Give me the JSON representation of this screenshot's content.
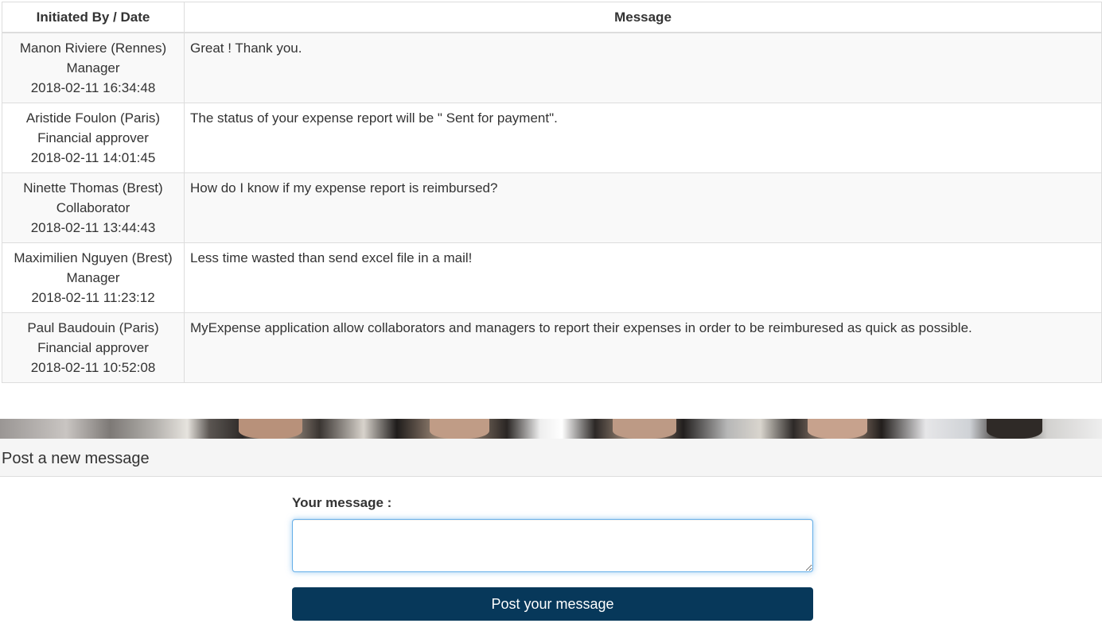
{
  "table": {
    "headers": {
      "initiator": "Initiated By / Date",
      "message": "Message"
    },
    "rows": [
      {
        "name": "Manon Riviere (Rennes)",
        "role": "Manager",
        "date": "2018-02-11 16:34:48",
        "message": "Great ! Thank you."
      },
      {
        "name": "Aristide Foulon (Paris)",
        "role": "Financial approver",
        "date": "2018-02-11 14:01:45",
        "message": "The status of your expense report will be \" Sent for payment\"."
      },
      {
        "name": "Ninette Thomas (Brest)",
        "role": "Collaborator",
        "date": "2018-02-11 13:44:43",
        "message": "How do I know if my expense report is reimbursed?"
      },
      {
        "name": "Maximilien Nguyen (Brest)",
        "role": "Manager",
        "date": "2018-02-11 11:23:12",
        "message": "Less time wasted than send excel file in a mail!"
      },
      {
        "name": "Paul Baudouin (Paris)",
        "role": "Financial approver",
        "date": "2018-02-11 10:52:08",
        "message": "MyExpense application allow collaborators and managers to report their expenses in order to be reimburesed as quick as possible."
      }
    ]
  },
  "post_panel": {
    "title": "Post a new message",
    "label": "Your message :",
    "textarea_value": "",
    "button_label": "Post your message"
  },
  "colors": {
    "button_bg": "#07385a",
    "focus_border": "#66afe9",
    "row_stripe": "#f9f9f9",
    "panel_header_bg": "#f5f5f5"
  }
}
